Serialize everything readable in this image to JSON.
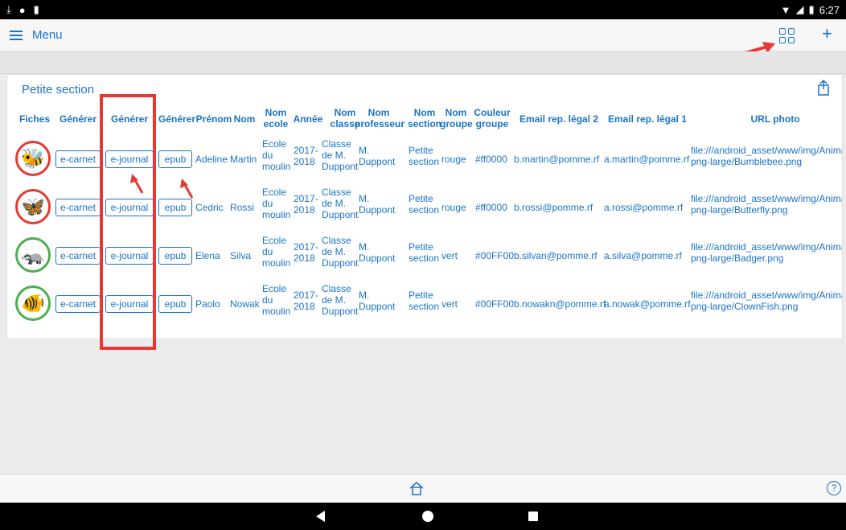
{
  "status_bar": {
    "time": "6:27"
  },
  "app_bar": {
    "menu_label": "Menu"
  },
  "section": {
    "title": "Petite section"
  },
  "table": {
    "headers": [
      "Fiches",
      "Générer",
      "Générer",
      "Générer",
      "Prénom",
      "Nom",
      "Nom ecole",
      "Année",
      "Nom classe",
      "Nom professeur",
      "Nom section",
      "Nom groupe",
      "Couleur groupe",
      "Email rep. légal 2",
      "Email rep. légal 1",
      "URL photo"
    ],
    "rows": [
      {
        "animal": "bee",
        "ring": "red",
        "btn_carnet": "e-carnet",
        "btn_journal": "e-journal",
        "btn_epub": "epub",
        "prenom": "Adeline",
        "nom": "Martin",
        "ecole": "Ecole du moulin",
        "annee": "2017-2018",
        "classe": "Classe de M. Duppont",
        "professeur": "M. Duppont",
        "section": "Petite section",
        "groupe": "rouge",
        "couleur": "#ff0000",
        "email2": "b.martin@pomme.rf",
        "email1": "a.martin@pomme.rf",
        "url": "file:///android_asset/www/img/Anima png-large/Bumblebee.png"
      },
      {
        "animal": "butterfly",
        "ring": "red",
        "btn_carnet": "e-carnet",
        "btn_journal": "e-journal",
        "btn_epub": "epub",
        "prenom": "Cedric",
        "nom": "Rossi",
        "ecole": "Ecole du moulin",
        "annee": "2017-2018",
        "classe": "Classe de M. Duppont",
        "professeur": "M. Duppont",
        "section": "Petite section",
        "groupe": "rouge",
        "couleur": "#ff0000",
        "email2": "b.rossi@pomme.rf",
        "email1": "a.rossi@pomme.rf",
        "url": "file:///android_asset/www/img/Anima png-large/Butterfly.png"
      },
      {
        "animal": "badger",
        "ring": "green",
        "btn_carnet": "e-carnet",
        "btn_journal": "e-journal",
        "btn_epub": "epub",
        "prenom": "Elena",
        "nom": "Silva",
        "ecole": "Ecole du moulin",
        "annee": "2017-2018",
        "classe": "Classe de M. Duppont",
        "professeur": "M. Duppont",
        "section": "Petite section",
        "groupe": "vert",
        "couleur": "#00FF00",
        "email2": "b.silvan@pomme.rf",
        "email1": "a.silva@pomme.rf",
        "url": "file:///android_asset/www/img/Anima png-large/Badger.png"
      },
      {
        "animal": "clownfish",
        "ring": "green",
        "btn_carnet": "e-carnet",
        "btn_journal": "e-journal",
        "btn_epub": "epub",
        "prenom": "Paolo",
        "nom": "Nowak",
        "ecole": "Ecole du moulin",
        "annee": "2017-2018",
        "classe": "Classe de M. Duppont",
        "professeur": "M. Duppont",
        "section": "Petite section",
        "groupe": "vert",
        "couleur": "#00FF00",
        "email2": "b.nowakn@pomme.rf",
        "email1": "a.nowak@pomme.rf",
        "url": "file:///android_asset/www/img/Anima png-large/ClownFish.png"
      }
    ]
  },
  "colors": {
    "accent": "#1a73c8",
    "annotation": "#e53935",
    "ring_red": "#e53935",
    "ring_green": "#4caf50"
  }
}
